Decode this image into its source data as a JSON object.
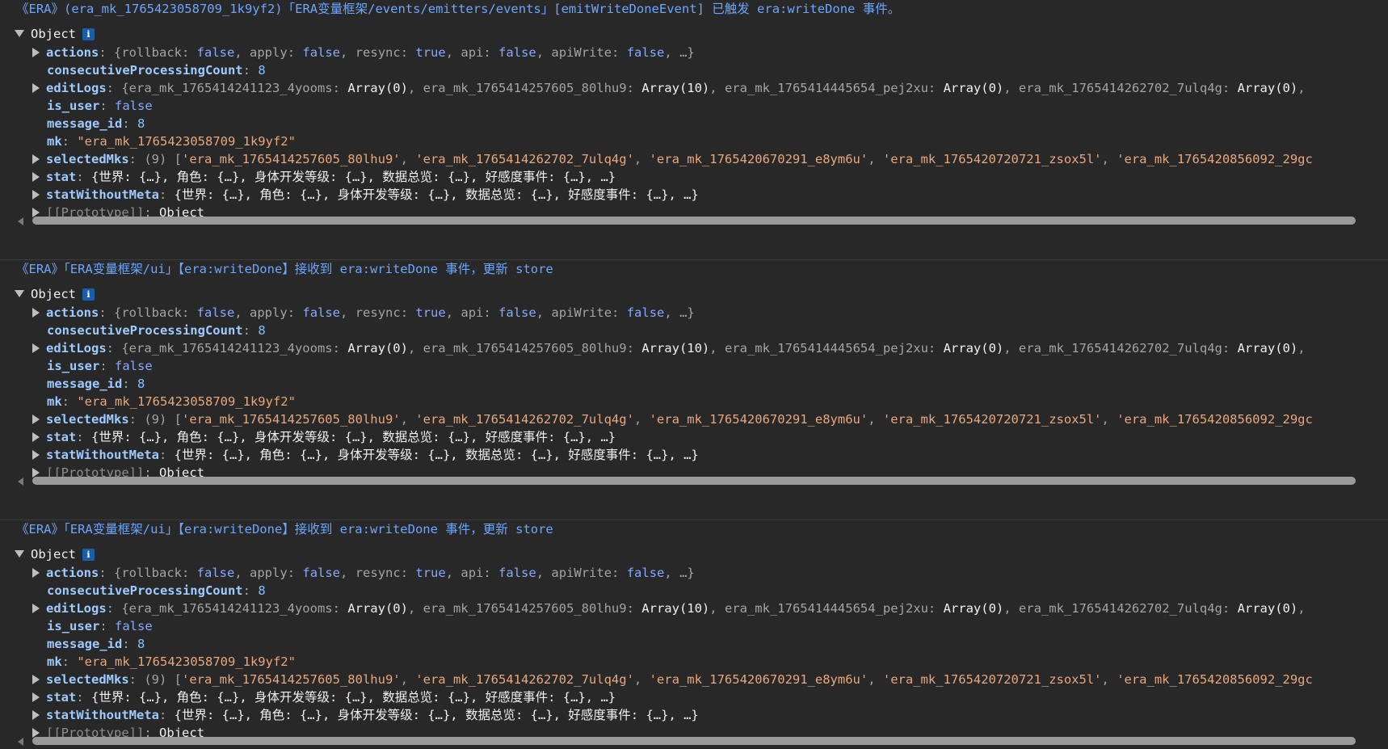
{
  "entries": [
    {
      "message": "《ERA》(era_mk_1765423058709_1k9yf2)「ERA变量框架/events/emitters/events」[emitWriteDoneEvent] 已触发 era:writeDone 事件。",
      "object_label": "Object",
      "info_icon": "i"
    },
    {
      "message": "《ERA》「ERA变量框架/ui」【era:writeDone】接收到 era:writeDone 事件，更新 store",
      "object_label": "Object",
      "info_icon": "i"
    },
    {
      "message": "《ERA》「ERA变量框架/ui」【era:writeDone】接收到 era:writeDone 事件，更新 store",
      "object_label": "Object",
      "info_icon": "i"
    }
  ],
  "props": {
    "actions": {
      "key": "actions",
      "open": "{",
      "pairs": [
        {
          "k": "rollback",
          "v": "false"
        },
        {
          "k": "apply",
          "v": "false"
        },
        {
          "k": "resync",
          "v": "true"
        },
        {
          "k": "api",
          "v": "false"
        },
        {
          "k": "apiWrite",
          "v": "false"
        }
      ],
      "tail": "…}"
    },
    "consecutiveProcessingCount": {
      "key": "consecutiveProcessingCount",
      "value": "8"
    },
    "editLogs": {
      "key": "editLogs",
      "open": "{",
      "pairs": [
        {
          "k": "era_mk_1765414241123_4yooms",
          "v": "Array(0)"
        },
        {
          "k": "era_mk_1765414257605_80lhu9",
          "v": "Array(10)"
        },
        {
          "k": "era_mk_1765414445654_pej2xu",
          "v": "Array(0)"
        },
        {
          "k": "era_mk_1765414262702_7ulq4g",
          "v": "Array(0)"
        }
      ]
    },
    "is_user": {
      "key": "is_user",
      "value": "false"
    },
    "message_id": {
      "key": "message_id",
      "value": "8"
    },
    "mk": {
      "key": "mk",
      "value": "\"era_mk_1765423058709_1k9yf2\""
    },
    "selectedMks": {
      "key": "selectedMks",
      "count": "(9)",
      "items": [
        "'era_mk_1765414257605_80lhu9'",
        "'era_mk_1765414262702_7ulq4g'",
        "'era_mk_1765420670291_e8ym6u'",
        "'era_mk_1765420720721_zsox5l'",
        "'era_mk_1765420856092_29gc"
      ]
    },
    "stat": {
      "key": "stat",
      "text": "{世界: {…}, 角色: {…}, 身体开发等级: {…}, 数据总览: {…}, 好感度事件: {…}, …}"
    },
    "statWithoutMeta": {
      "key": "statWithoutMeta",
      "text": "{世界: {…}, 角色: {…}, 身体开发等级: {…}, 数据总览: {…}, 好感度事件: {…}, …}"
    },
    "prototype": {
      "key": "[[Prototype]]",
      "value": "Object"
    }
  },
  "icons": {
    "expand": "triangle-down-icon",
    "collapse": "triangle-right-icon",
    "info": "info-icon",
    "scroll_left": "scroll-left-arrow-icon"
  },
  "colors": {
    "background": "#282828",
    "message": "#6ca6ff",
    "key": "#9ecbff",
    "string": "#e8a77c",
    "boolean": "#87a9ff",
    "number": "#7fc1ff"
  }
}
